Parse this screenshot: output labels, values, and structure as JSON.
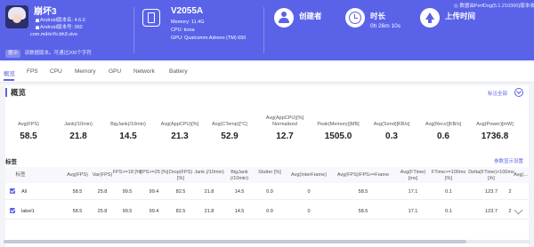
{
  "header": {
    "app_name": "崩坏3",
    "android_version": "Android版本名: 4.6.0",
    "android_code": "Android版本号: 360",
    "package": "com.miHoYo.bh3.vivo",
    "device_model": "V2055A",
    "memory": "Memory: 11.4G",
    "cpu": "CPU: kona",
    "gpu": "GPU: Qualcomm Adreno (TM) 650",
    "creator_title": "创建者",
    "creator_value": "",
    "duration_title": "时长",
    "duration_value": "0h 26m 10s",
    "upload_title": "上传时间",
    "upload_value": "",
    "report_link": "◎ 数据由PerfDog(5.1.210300)版本收集",
    "notice_tag": "提示",
    "notice_text": "该数据版本。可通过200个字符"
  },
  "tabs": [
    "概览",
    "FPS",
    "CPU",
    "Memory",
    "GPU",
    "Network",
    "Battery"
  ],
  "panel": {
    "title": "概览",
    "collapse_label": "标注全部"
  },
  "metrics": [
    {
      "label": "Avg(FPS)",
      "value": "58.5"
    },
    {
      "label": "Jank(/10min)",
      "value": "21.8"
    },
    {
      "label": "BigJank(/10min)",
      "value": "14.5"
    },
    {
      "label": "Avg(AppCPU)[%]",
      "value": "21.3"
    },
    {
      "label": "Avg(CTemp)[°C]",
      "value": "52.9"
    },
    {
      "label": "Avg(AppCPU)[%] Normalized",
      "value": "12.7"
    },
    {
      "label": "Peak(Memory)[MB]",
      "value": "1505.0"
    },
    {
      "label": "Avg(Send)[KB/s]",
      "value": "0.3"
    },
    {
      "label": "Avg(Recv)[KB/s]",
      "value": "0.6"
    },
    {
      "label": "Avg(Power)[mW]",
      "value": "1736.8"
    }
  ],
  "labels_section": {
    "title": "标签",
    "settings_link": "参数显示设置"
  },
  "table": {
    "headers": [
      "标签",
      "Avg(FPS)",
      "Var(FPS)",
      "FPS>=18 [%]",
      "FPS>=25 [%]",
      "Drop(FPS) [%]",
      "Jank (/10min)",
      "BigJank (/10min)",
      "Stutter [%]",
      "Avg(InterFrame)",
      "Avg(FPS)/FPS>=Frame",
      "Avg(FTime) [ms]",
      "FTime>=100ms [%]",
      "Delta(FTime)>100ms [/h]",
      "Avg(..."
    ],
    "rows": [
      {
        "name": "All",
        "cells": [
          "58.5",
          "25.8",
          "99.5",
          "99.4",
          "82.5",
          "21.8",
          "14.5",
          "0.9",
          "0",
          "58.5",
          "17.1",
          "0.1",
          "123.7",
          "2"
        ]
      },
      {
        "name": "label1",
        "cells": [
          "58.5",
          "25.8",
          "99.5",
          "99.4",
          "82.5",
          "21.8",
          "14.5",
          "0.9",
          "0",
          "58.5",
          "17.1",
          "0.1",
          "123.7",
          "2"
        ]
      }
    ]
  },
  "colors": {
    "accent": "#5a63e8",
    "header_bg": "#5a63e8",
    "page_bg": "#f3f4f8"
  }
}
